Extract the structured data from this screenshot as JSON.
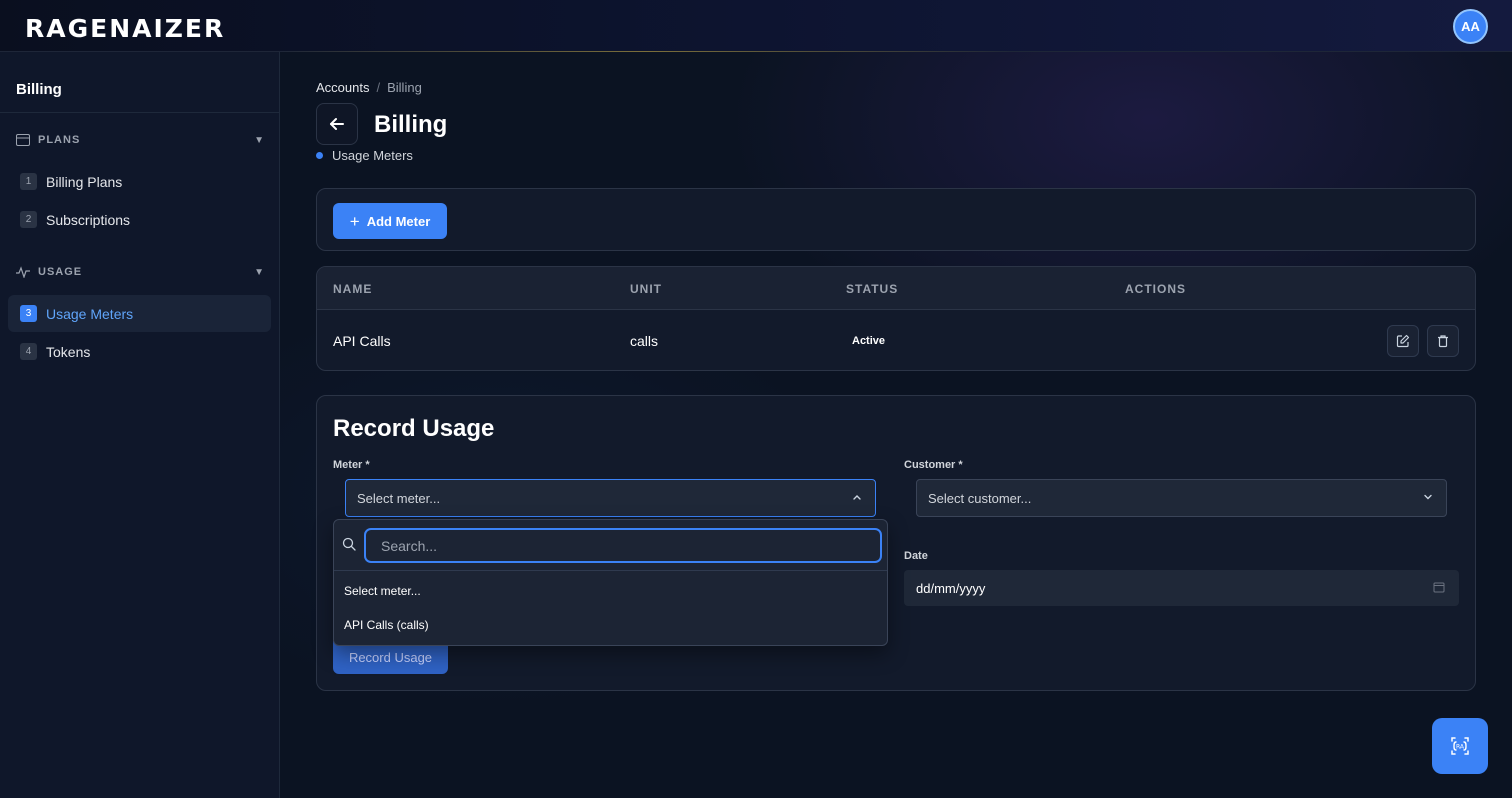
{
  "app": {
    "logo": "RAGENAIZER",
    "avatar_initials": "AA"
  },
  "sidebar": {
    "title": "Billing",
    "sections": [
      {
        "label": "PLANS",
        "icon": "credit-card-icon",
        "items": [
          {
            "num": "1",
            "label": "Billing Plans"
          },
          {
            "num": "2",
            "label": "Subscriptions"
          }
        ]
      },
      {
        "label": "USAGE",
        "icon": "activity-icon",
        "items": [
          {
            "num": "3",
            "label": "Usage Meters",
            "active": true
          },
          {
            "num": "4",
            "label": "Tokens"
          }
        ]
      }
    ]
  },
  "breadcrumb": {
    "parent": "Accounts",
    "separator": "/",
    "current": "Billing"
  },
  "page": {
    "title": "Billing",
    "subtitle": "Usage Meters"
  },
  "toolbar": {
    "add_label": "Add Meter"
  },
  "table": {
    "columns": [
      "NAME",
      "UNIT",
      "STATUS",
      "ACTIONS"
    ],
    "rows": [
      {
        "name": "API Calls",
        "unit": "calls",
        "status": "Active"
      }
    ]
  },
  "record_form": {
    "title": "Record Usage",
    "meter_label": "Meter *",
    "meter_placeholder": "Select meter...",
    "customer_label": "Customer *",
    "customer_placeholder": "Select customer...",
    "date_label": "Date",
    "date_placeholder": "dd/mm/yyyy",
    "submit_label": "Record Usage"
  },
  "meter_dropdown": {
    "search_placeholder": "Search...",
    "options": [
      "Select meter...",
      "API Calls (calls)"
    ]
  },
  "colors": {
    "accent": "#3b82f6",
    "background": "#0b1322",
    "sidebar": "#0f172a"
  }
}
